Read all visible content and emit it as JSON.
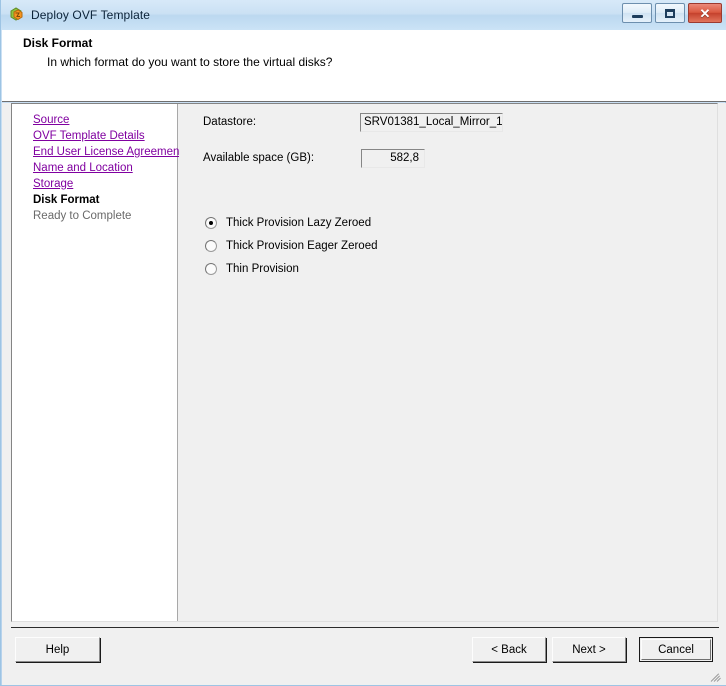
{
  "window": {
    "title": "Deploy OVF Template",
    "icon": "ovf-template-icon",
    "controls": {
      "minimize": "minimize-icon",
      "maximize": "maximize-icon",
      "close": "✕"
    }
  },
  "header": {
    "title": "Disk Format",
    "subtitle": "In which format do you want to store the virtual disks?"
  },
  "sidebar": {
    "items": [
      {
        "label": "Source",
        "state": "link"
      },
      {
        "label": "OVF Template Details",
        "state": "link"
      },
      {
        "label": "End User License Agreement",
        "state": "link"
      },
      {
        "label": "Name and Location",
        "state": "link"
      },
      {
        "label": "Storage",
        "state": "link"
      },
      {
        "label": "Disk Format",
        "state": "current"
      },
      {
        "label": "Ready to Complete",
        "state": "upcoming"
      }
    ]
  },
  "main": {
    "datastore": {
      "label": "Datastore:",
      "value": "SRV01381_Local_Mirror_1"
    },
    "available_space": {
      "label": "Available space (GB):",
      "value": "582,8"
    },
    "disk_format_options": [
      {
        "label": "Thick Provision Lazy Zeroed",
        "selected": true
      },
      {
        "label": "Thick Provision Eager Zeroed",
        "selected": false
      },
      {
        "label": "Thin Provision",
        "selected": false
      }
    ]
  },
  "footer": {
    "help": "Help",
    "back": "< Back",
    "next": "Next >",
    "cancel": "Cancel"
  },
  "colors": {
    "link": "#8000a0",
    "titlebar_text": "#0b2238",
    "close_button": "#c4402c",
    "dialog_background": "#f0f0f0"
  }
}
